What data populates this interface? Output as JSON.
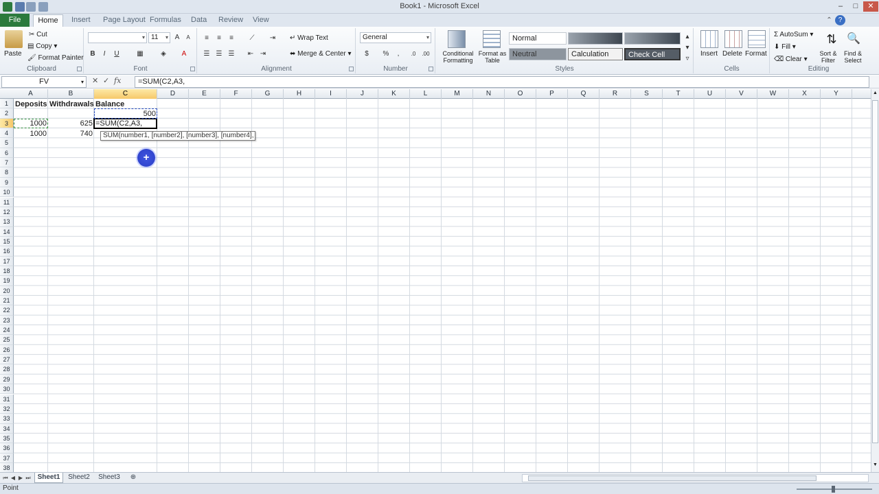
{
  "window": {
    "title": "Book1 - Microsoft Excel"
  },
  "tabs": {
    "file": "File",
    "home": "Home",
    "insert": "Insert",
    "page_layout": "Page Layout",
    "formulas": "Formulas",
    "data": "Data",
    "review": "Review",
    "view": "View"
  },
  "ribbon": {
    "clipboard": {
      "label": "Clipboard",
      "paste": "Paste",
      "cut": "Cut",
      "copy": "Copy",
      "format_painter": "Format Painter"
    },
    "font": {
      "label": "Font",
      "size": "11",
      "bold": "B",
      "italic": "I",
      "underline": "U"
    },
    "alignment": {
      "label": "Alignment",
      "wrap_text": "Wrap Text",
      "merge_center": "Merge & Center"
    },
    "number": {
      "label": "Number",
      "format": "General",
      "currency": "$",
      "percent": "%",
      "comma": ","
    },
    "styles": {
      "label": "Styles",
      "conditional_formatting": "Conditional Formatting",
      "format_as_table": "Format as Table",
      "normal": "Normal",
      "neutral": "Neutral",
      "calculation": "Calculation",
      "check_cell": "Check Cell"
    },
    "cells": {
      "label": "Cells",
      "insert": "Insert",
      "delete": "Delete",
      "format": "Format"
    },
    "editing": {
      "label": "Editing",
      "autosum": "AutoSum",
      "fill": "Fill",
      "clear": "Clear",
      "sort_filter": "Sort & Filter",
      "find_select": "Find & Select"
    }
  },
  "formula_bar": {
    "name_box": "FV",
    "formula": "=SUM(C2,A3,"
  },
  "columns": [
    "A",
    "B",
    "C",
    "D",
    "E",
    "F",
    "G",
    "H",
    "I",
    "J",
    "K",
    "L",
    "M",
    "N",
    "O",
    "P",
    "Q",
    "R",
    "S",
    "T",
    "U",
    "V",
    "W",
    "X",
    "Y"
  ],
  "rows": [
    "1",
    "2",
    "3",
    "4",
    "5",
    "6",
    "7",
    "8",
    "9",
    "10",
    "11",
    "12",
    "13",
    "14",
    "15",
    "16",
    "17",
    "18",
    "19",
    "20",
    "21",
    "22",
    "23",
    "24",
    "25",
    "26",
    "27",
    "28",
    "29",
    "30",
    "31",
    "32",
    "33",
    "34",
    "35",
    "36",
    "37",
    "38"
  ],
  "cells": {
    "A1": "Deposits",
    "B1": "Withdrawals",
    "C1": "Balance",
    "C2": "500",
    "A3": "1000",
    "B3": "625",
    "C3": "=SUM(C2,A3,",
    "A4": "1000",
    "B4": "740"
  },
  "tooltip": "SUM(number1, [number2], [number3], [number4], ...)",
  "sheets": [
    "Sheet1",
    "Sheet2",
    "Sheet3"
  ],
  "status": {
    "mode": "Point"
  },
  "colors": {
    "file_tab": "#2b7a3d",
    "selected_header": "#f6c86a",
    "active_border": "#000000",
    "cursor": "#2b3fc7"
  }
}
